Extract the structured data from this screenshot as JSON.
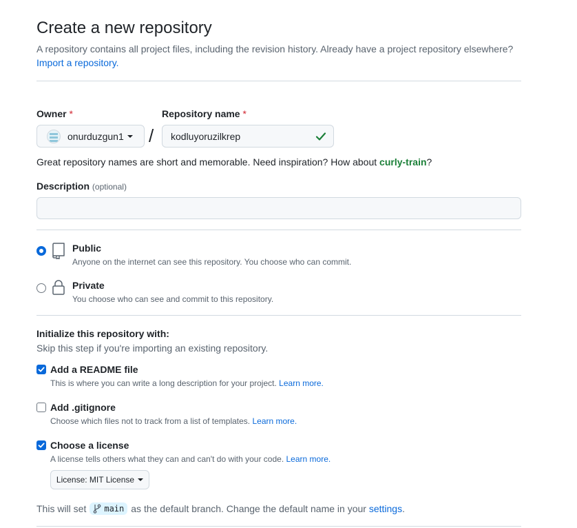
{
  "header": {
    "title": "Create a new repository",
    "subtitle": "A repository contains all project files, including the revision history. Already have a project repository elsewhere?",
    "import_link": "Import a repository."
  },
  "owner": {
    "label": "Owner",
    "required_mark": "*",
    "value": "onurduzgun1"
  },
  "repo_name": {
    "label": "Repository name",
    "required_mark": "*",
    "value": "kodluyoruzilkrep"
  },
  "name_hint": {
    "text": "Great repository names are short and memorable. Need inspiration? How about",
    "suggestion": "curly-train",
    "suffix": "?"
  },
  "description": {
    "label": "Description",
    "optional": "(optional)",
    "value": ""
  },
  "visibility": {
    "public": {
      "title": "Public",
      "desc": "Anyone on the internet can see this repository. You choose who can commit.",
      "selected": true
    },
    "private": {
      "title": "Private",
      "desc": "You choose who can see and commit to this repository.",
      "selected": false
    }
  },
  "init": {
    "title": "Initialize this repository with:",
    "subtitle": "Skip this step if you're importing an existing repository.",
    "readme": {
      "label": "Add a README file",
      "desc": "This is where you can write a long description for your project.",
      "link": "Learn more.",
      "checked": true
    },
    "gitignore": {
      "label": "Add .gitignore",
      "desc": "Choose which files not to track from a list of templates.",
      "link": "Learn more.",
      "checked": false
    },
    "license": {
      "label": "Choose a license",
      "desc": "A license tells others what they can and can't do with your code.",
      "link": "Learn more.",
      "checked": true,
      "dropdown": "License: MIT License"
    }
  },
  "branch_note": {
    "prefix": "This will set",
    "branch": "main",
    "middle": "as the default branch. Change the default name in your",
    "link": "settings",
    "suffix": "."
  },
  "colors": {
    "accent": "#0969da",
    "success": "#1a7f37",
    "required": "#d1242f"
  }
}
